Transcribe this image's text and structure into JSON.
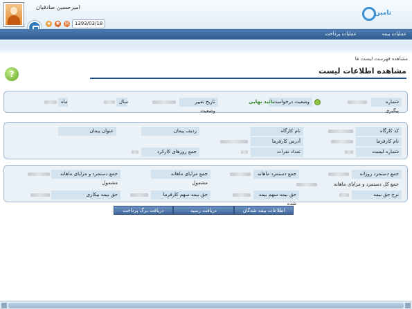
{
  "header": {
    "username": "امیرحسین صادقیان",
    "date": "1393/03/18",
    "brand_text": "تامین"
  },
  "nav": {
    "items": [
      "عملیات بیمه",
      "عملیات پرداخت"
    ]
  },
  "breadcrumb": "مشاهده فهرست لیست ها",
  "page_title": "مشاهده اطلاعات لیست",
  "panel1": {
    "tracking_label": "شماره پیگیری",
    "request_status_label": "وضعیت درخواست",
    "request_status_value": "تائید نهایی",
    "status_change_date_label": "تاریخ تغییر وضعیت",
    "year_label": "سال",
    "month_label": "ماه"
  },
  "panel2": {
    "workshop_code_label": "کد کارگاه",
    "workshop_name_label": "نام کارگاه",
    "contract_row_label": "ردیف پیمان",
    "contract_title_label": "عنوان پیمان",
    "employer_name_label": "نام کارفرما",
    "employer_address_label": "آدرس کارفرما",
    "list_number_label": "شماره لیست",
    "headcount_label": "تعداد نفرات",
    "workdays_total_label": "جمع روزهای کارکرد"
  },
  "panel3": {
    "daily_wage_total_label": "جمع دستمزد روزانه",
    "monthly_wage_total_label": "جمع دستمزد ماهانه",
    "monthly_benefits_label": "جمع مزایای ماهانه مشمول",
    "wage_and_benefits_label": "جمع دستمزد و مزایای ماهانه مشمول",
    "grand_total_label": "جمع کل دستمزد و مزایای ماهانه",
    "insurance_rate_label": "نرخ حق بیمه",
    "insured_share_label": "حق بیمه سهم بیمه شده",
    "employer_share_label": "حق بیمه سهم کارفرما",
    "unemployment_label": "حق بیمه بیکاری"
  },
  "buttons": {
    "insured_info": "اطلاعات بیمه شدگان",
    "receipt": "دریافت رسید",
    "payment_slip": "دریافت برگ پرداخت"
  },
  "colors": {
    "nav_bar": "#3a6aa0",
    "label_bg": "#d4e3f0",
    "status_green": "#2d7d1c",
    "button_bg": "#5a81b3"
  }
}
